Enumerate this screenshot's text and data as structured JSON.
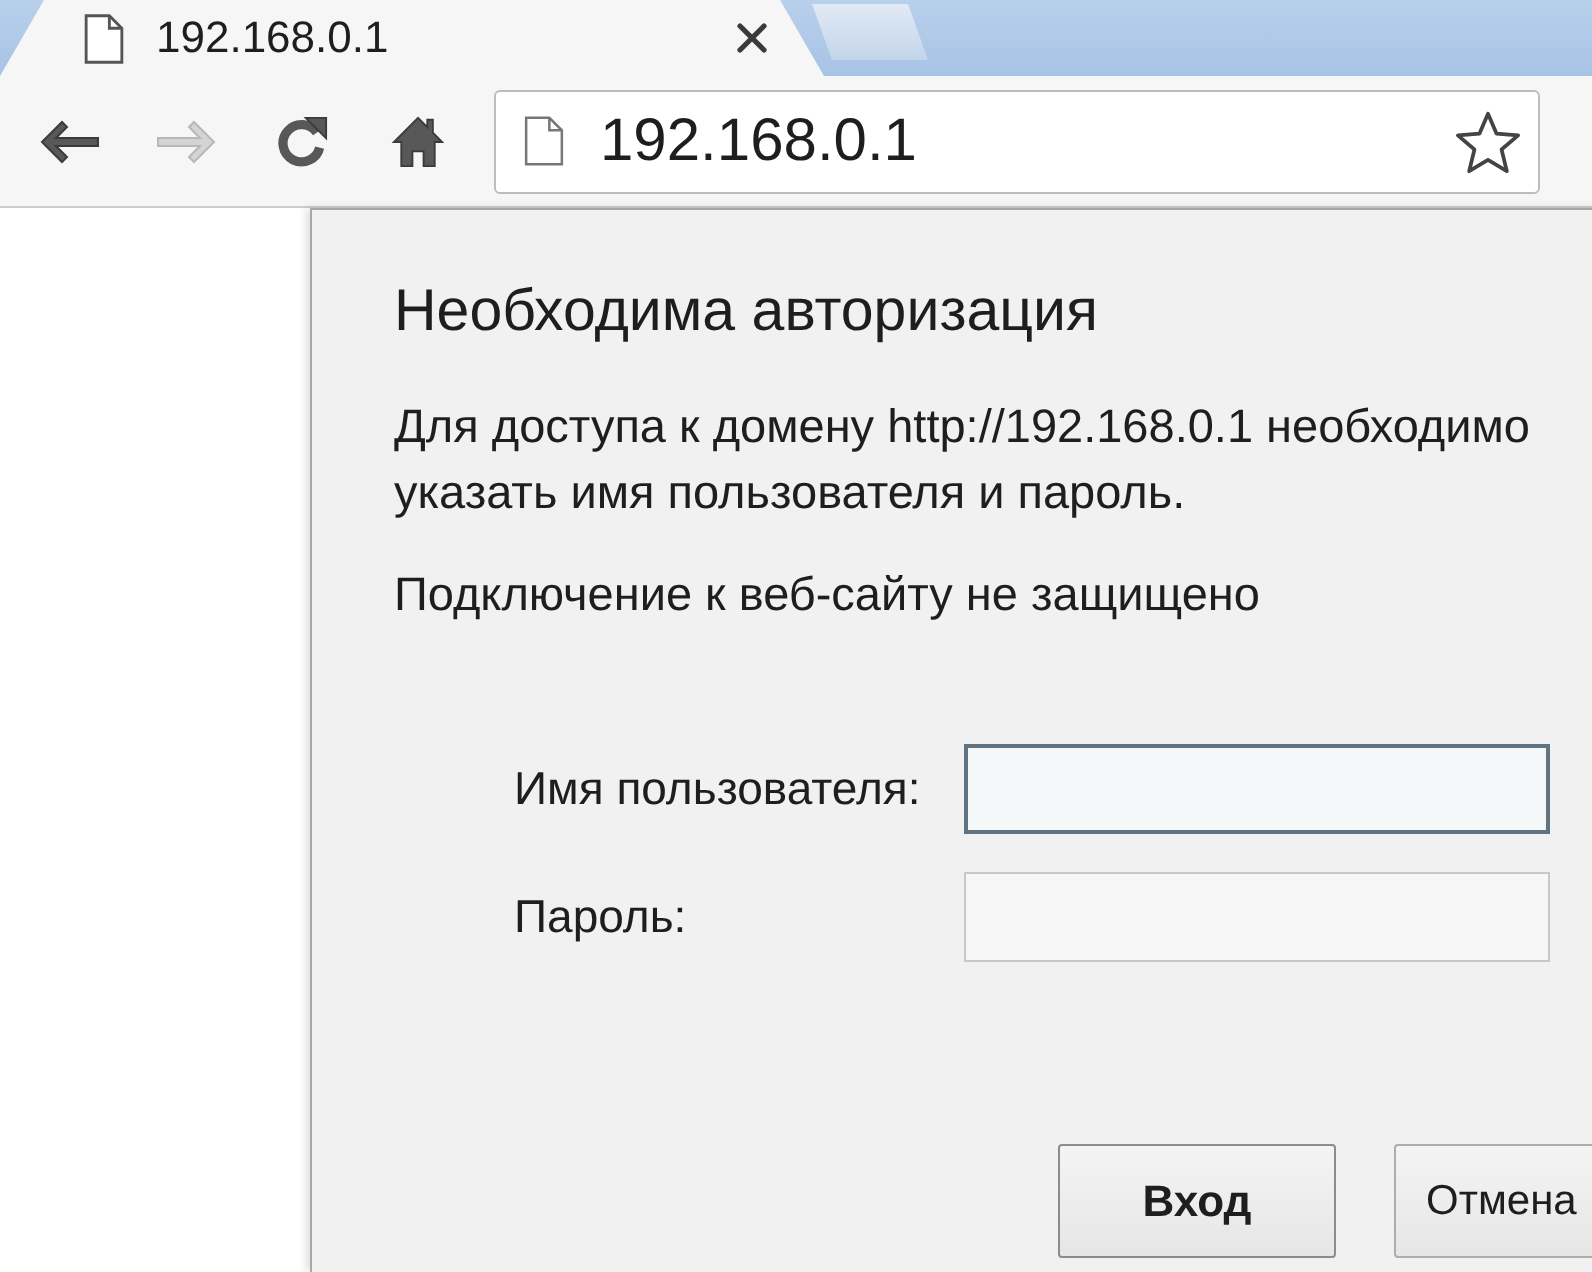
{
  "tabs": [
    {
      "title": "192.168.0.1",
      "selected": true
    }
  ],
  "toolbar": {
    "buttons": [
      {
        "kind": "back",
        "disabled": false
      },
      {
        "kind": "forward",
        "disabled": true
      },
      {
        "kind": "reload",
        "disabled": false
      },
      {
        "kind": "home",
        "disabled": false
      }
    ],
    "address": "192.168.0.1"
  },
  "dialog": {
    "title": "Необходима авторизация",
    "message": "Для доступа к домену http://192.168.0.1 необходимо указать имя пользователя и пароль.",
    "security_note": "Подключение к веб-сайту не защищено",
    "fields": [
      {
        "label": "Имя пользователя:",
        "focused": true
      },
      {
        "label": "Пароль:",
        "focused": false
      }
    ],
    "buttons": [
      {
        "label": "Вход",
        "default": true
      },
      {
        "label": "Отмена",
        "default": false
      }
    ]
  }
}
